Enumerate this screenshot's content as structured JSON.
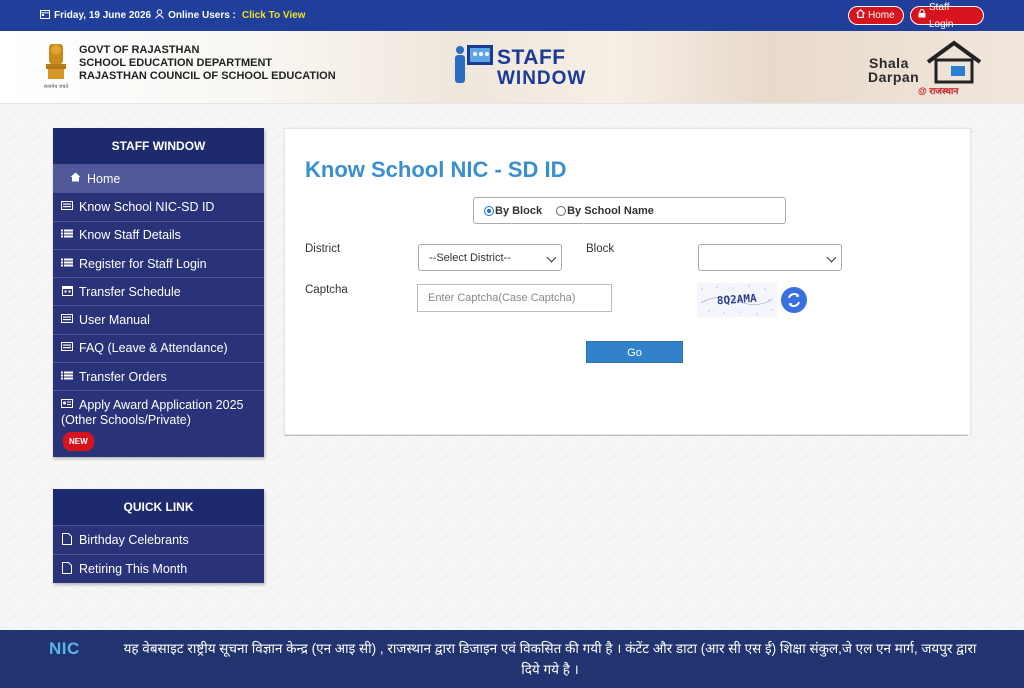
{
  "topbar": {
    "date": "Friday, 19 June 2026",
    "online_users_label": "Online Users :",
    "online_users_link": "Click To View",
    "home_button": "Home",
    "staff_login_button": "Staff Login"
  },
  "header": {
    "govt_lines": [
      "GOVT OF RAJASTHAN",
      "SCHOOL EDUCATION DEPARTMENT",
      "RAJASTHAN COUNCIL OF SCHOOL EDUCATION"
    ],
    "emblem_caption": "सत्यमेव जयते",
    "staff_window_line1": "STAFF",
    "staff_window_line2": "WINDOW",
    "shala_line1": "Shala",
    "shala_line2": "Darpan",
    "shala_line3": "@ राजस्थान"
  },
  "sidebar": {
    "staff_title": "STAFF WINDOW",
    "items": [
      {
        "label": "Home",
        "icon": "home-icon"
      },
      {
        "label": "Know School NIC-SD ID",
        "icon": "card-icon"
      },
      {
        "label": "Know Staff Details",
        "icon": "list-icon"
      },
      {
        "label": "Register for Staff Login",
        "icon": "list-icon"
      },
      {
        "label": "Transfer Schedule",
        "icon": "calendar-icon"
      },
      {
        "label": "User Manual",
        "icon": "card-icon"
      },
      {
        "label": "FAQ (Leave & Attendance)",
        "icon": "card-icon"
      },
      {
        "label": "Transfer Orders",
        "icon": "list-icon"
      }
    ],
    "award_line1": "Apply Award Application 2025",
    "award_line2": "(Other Schools/Private)",
    "new_badge": "NEW",
    "quick_title": "QUICK LINK",
    "quick_items": [
      {
        "label": "Birthday Celebrants",
        "icon": "file-icon"
      },
      {
        "label": "Retiring This Month",
        "icon": "file-icon"
      }
    ]
  },
  "main": {
    "title": "Know School NIC - SD ID",
    "radio_by_block": "By Block",
    "radio_by_school": "By School Name",
    "selected_radio": "By Block",
    "district_label": "District",
    "district_value": "--Select District--",
    "block_label": "Block",
    "block_value": "",
    "captcha_label": "Captcha",
    "captcha_placeholder": "Enter Captcha(Case Captcha)",
    "captcha_text": "8Q2AMA",
    "go_button": "Go"
  },
  "footer": {
    "nic_logo": "NIC",
    "text": "यह वेबसाइट राष्ट्रीय सूचना विज्ञान केन्द्र (एन आइ सी) , राजस्थान द्वारा डिजाइन एवं विकसित की गयी है । कंटेंट और डाटा (आर सी एस ई) शिक्षा संकुल,जे एल एन मार्ग, जयपुर द्वारा दिये गये है ।"
  },
  "colors": {
    "topbar": "#1f3f9a",
    "sidebar": "#2a337a",
    "accent_red": "#d7141d",
    "title_blue": "#3a8fce",
    "footer": "#22346f"
  }
}
